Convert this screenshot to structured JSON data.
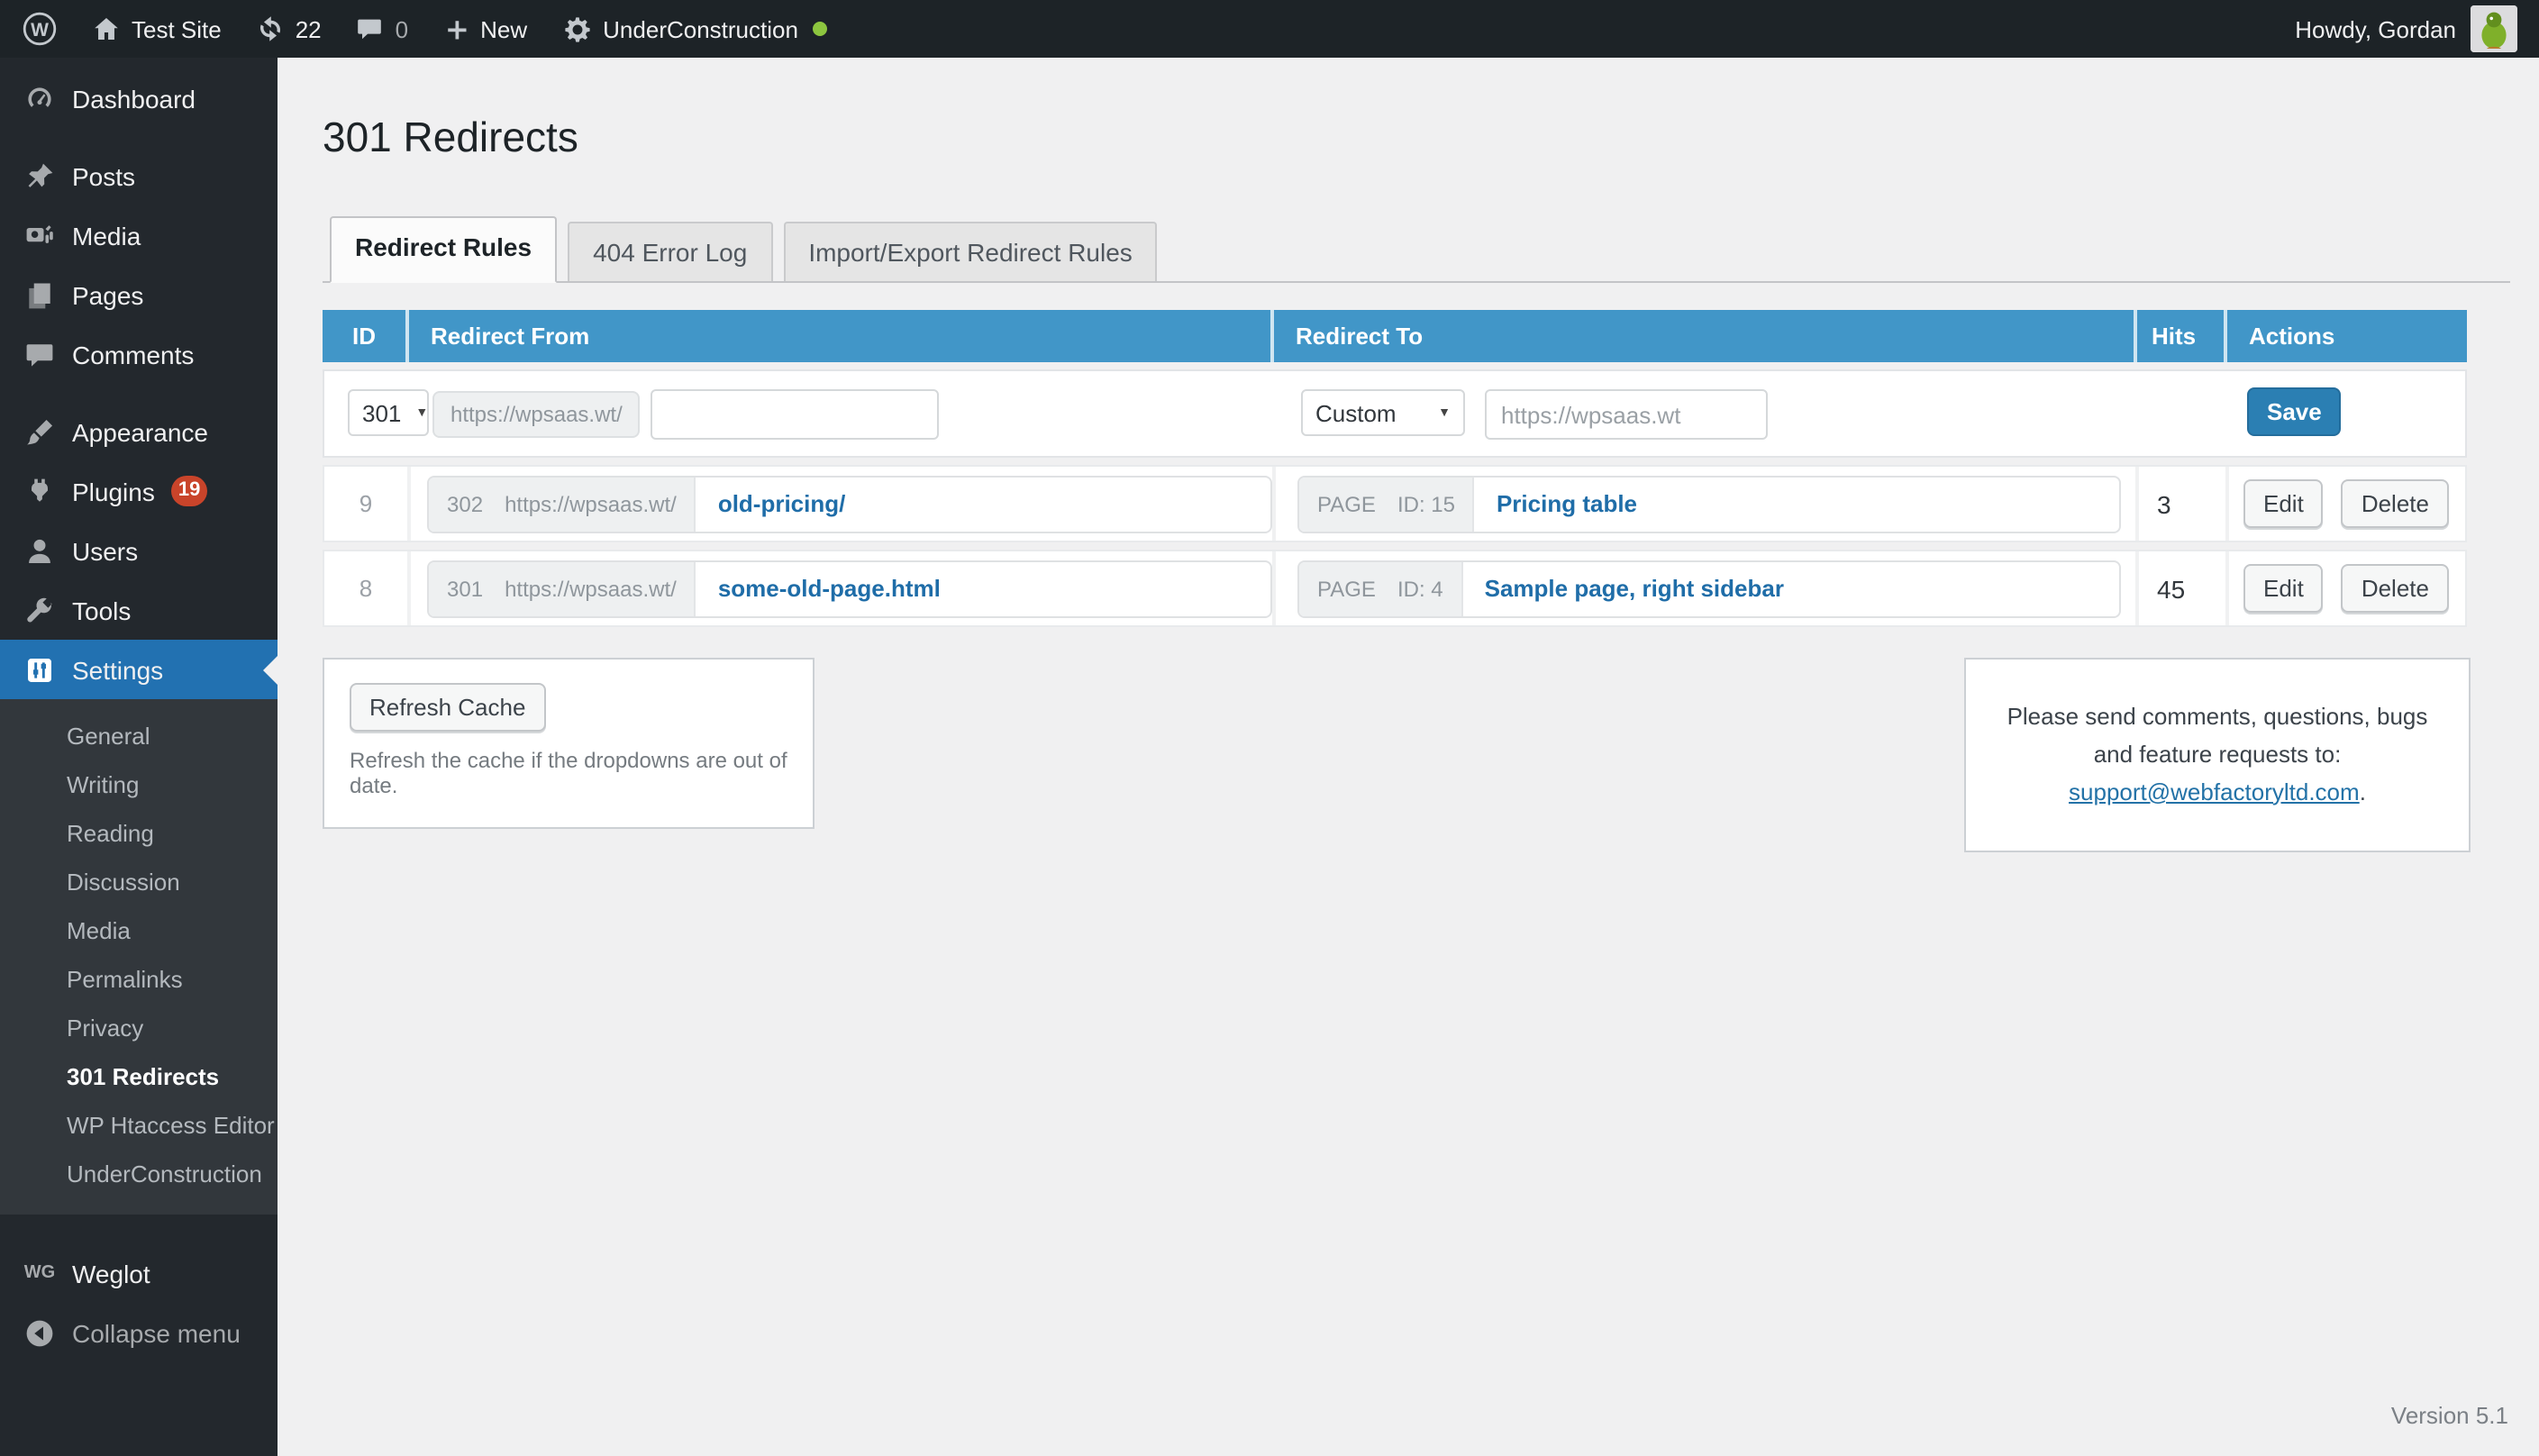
{
  "admin_bar": {
    "site_name": "Test Site",
    "update_count": "22",
    "comment_count": "0",
    "new_label": "New",
    "underconstruction_label": "UnderConstruction",
    "howdy": "Howdy, Gordan"
  },
  "sidebar": {
    "menu": [
      {
        "label": "Dashboard"
      },
      {
        "label": "Posts"
      },
      {
        "label": "Media"
      },
      {
        "label": "Pages"
      },
      {
        "label": "Comments"
      },
      {
        "label": "Appearance"
      },
      {
        "label": "Plugins",
        "badge": "19"
      },
      {
        "label": "Users"
      },
      {
        "label": "Tools"
      },
      {
        "label": "Settings"
      }
    ],
    "submenu": [
      "General",
      "Writing",
      "Reading",
      "Discussion",
      "Media",
      "Permalinks",
      "Privacy",
      "301 Redirects",
      "WP Htaccess Editor",
      "UnderConstruction"
    ],
    "weglot_label": "Weglot",
    "weglot_icon_text": "WG",
    "collapse_label": "Collapse menu"
  },
  "page": {
    "title": "301 Redirects",
    "tabs": [
      "Redirect Rules",
      "404 Error Log",
      "Import/Export Redirect Rules"
    ],
    "version": "Version 5.1"
  },
  "table": {
    "headers": {
      "id": "ID",
      "from": "Redirect From",
      "to": "Redirect To",
      "hits": "Hits",
      "actions": "Actions"
    },
    "new_rule": {
      "code": "301",
      "prefix": "https://wpsaas.wt/",
      "from_value": "",
      "to_type": "Custom",
      "to_placeholder": "https://wpsaas.wt",
      "save_label": "Save"
    },
    "rows": [
      {
        "id": "9",
        "code": "302",
        "prefix": "https://wpsaas.wt/",
        "from": "old-pricing/",
        "to_kind": "PAGE",
        "to_ref": "ID: 15",
        "to": "Pricing table",
        "hits": "3"
      },
      {
        "id": "8",
        "code": "301",
        "prefix": "https://wpsaas.wt/",
        "from": "some-old-page.html",
        "to_kind": "PAGE",
        "to_ref": "ID: 4",
        "to": "Sample page, right sidebar",
        "hits": "45"
      }
    ],
    "row_actions": {
      "edit": "Edit",
      "delete": "Delete"
    }
  },
  "cache_box": {
    "button": "Refresh Cache",
    "note": "Refresh the cache if the dropdowns are out of date."
  },
  "support_box": {
    "line1": "Please send comments, questions, bugs",
    "line2": "and feature requests to:",
    "email": "support@webfactoryltd.com",
    "suffix": "."
  },
  "colors": {
    "table_header_blue": "#4196c8",
    "active_menu_blue": "#2271b1",
    "save_button_blue": "#2b7fb3",
    "link_blue": "#1f6da8",
    "plugins_badge_red": "#c9442a",
    "online_dot_green": "#8dc63f"
  }
}
